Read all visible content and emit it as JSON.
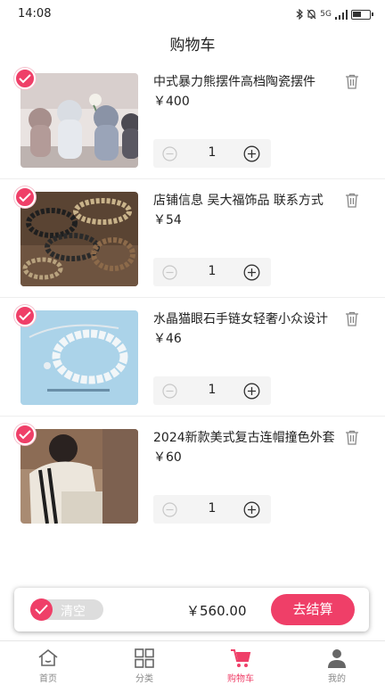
{
  "status_bar": {
    "time": "14:08",
    "network": "5G"
  },
  "page": {
    "title": "购物车"
  },
  "cart_items": [
    {
      "name": "中式暴力熊摆件高档陶瓷摆件",
      "price": "￥400",
      "quantity": "1",
      "selected": true
    },
    {
      "name": "店铺信息 吴大福饰品 联系方式",
      "price": "￥54",
      "quantity": "1",
      "selected": true
    },
    {
      "name": "水晶猫眼石手链女轻奢小众设计",
      "price": "￥46",
      "quantity": "1",
      "selected": true
    },
    {
      "name": "2024新款美式复古连帽撞色外套",
      "price": "￥60",
      "quantity": "1",
      "selected": true
    }
  ],
  "cart_bar": {
    "clear_label": "清空",
    "total": "￥560.00",
    "checkout_label": "去结算"
  },
  "tabs": [
    {
      "label": "首页",
      "icon": "home-icon",
      "active": false
    },
    {
      "label": "分类",
      "icon": "grid-icon",
      "active": false
    },
    {
      "label": "购物车",
      "icon": "cart-icon",
      "active": true
    },
    {
      "label": "我的",
      "icon": "user-icon",
      "active": false
    }
  ],
  "colors": {
    "accent": "#ef3f68",
    "inactive_tab": "#888888"
  }
}
